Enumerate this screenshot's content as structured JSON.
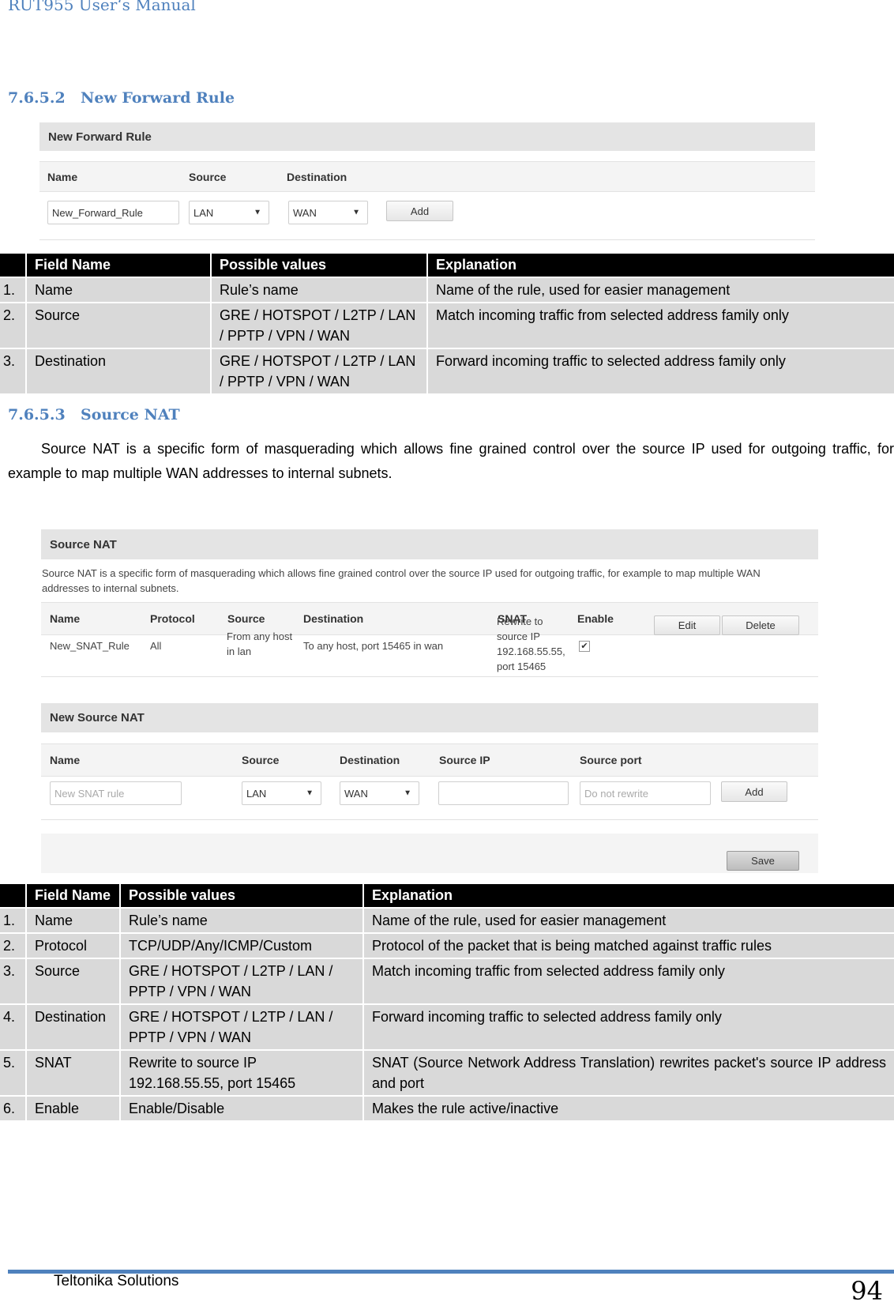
{
  "header": {
    "title": "RUT955 User‘s Manual"
  },
  "section1": {
    "number": "7.6.5.2",
    "title": "New Forward Rule",
    "screenshot": {
      "panel_title": "New Forward Rule",
      "columns": [
        "Name",
        "Source",
        "Destination"
      ],
      "name_value": "New_Forward_Rule",
      "source_value": "LAN",
      "destination_value": "WAN",
      "add_label": "Add",
      "arrow": "▼"
    },
    "table": {
      "headers": [
        "",
        "Field Name",
        "Possible values",
        "Explanation"
      ],
      "rows": [
        [
          "1.",
          "Name",
          "Rule’s name",
          "Name of the rule, used for easier management"
        ],
        [
          "2.",
          "Source",
          "GRE / HOTSPOT / L2TP / LAN / PPTP / VPN / WAN",
          "Match incoming traffic from selected address family only"
        ],
        [
          "3.",
          "Destination",
          "GRE / HOTSPOT / L2TP / LAN / PPTP / VPN / WAN",
          "Forward incoming traffic to selected address family only"
        ]
      ]
    }
  },
  "section2": {
    "number": "7.6.5.3",
    "title": "Source NAT",
    "paragraph": "Source NAT is a specific form of masquerading which allows fine grained control over the source IP used for outgoing traffic, for example to map multiple WAN addresses to internal subnets.",
    "screenshot": {
      "panel_title": "Source NAT",
      "description": "Source NAT is a specific form of masquerading which allows fine grained control over the source IP used for outgoing traffic, for example to map multiple WAN addresses to internal subnets.",
      "columns": [
        "Name",
        "Protocol",
        "Source",
        "Destination",
        "SNAT",
        "Enable"
      ],
      "rule": {
        "name": "New_SNAT_Rule",
        "protocol": "All",
        "source": "From any host in lan",
        "destination": "To any host, port 15465 in wan",
        "snat": "Rewrite to source IP 192.168.55.55, port 15465",
        "enabled_mark": "✔",
        "edit_label": "Edit",
        "delete_label": "Delete"
      },
      "new_panel_title": "New Source NAT",
      "new_columns": [
        "Name",
        "Source",
        "Destination",
        "Source IP",
        "Source port"
      ],
      "new_name_placeholder": "New SNAT rule",
      "new_source_value": "LAN",
      "new_destination_value": "WAN",
      "new_source_ip_value": "",
      "new_source_port_placeholder": "Do not rewrite",
      "add_label": "Add",
      "save_label": "Save",
      "arrow": "▼"
    },
    "table": {
      "headers": [
        "",
        "Field Name",
        "Possible values",
        "Explanation"
      ],
      "rows": [
        [
          "1.",
          "Name",
          "Rule’s name",
          "Name of the rule, used for easier management"
        ],
        [
          "2.",
          "Protocol",
          "TCP/UDP/Any/ICMP/Custom",
          "Protocol of the packet that is being matched against traffic rules"
        ],
        [
          "3.",
          "Source",
          "GRE / HOTSPOT / L2TP / LAN / PPTP / VPN / WAN",
          "Match incoming traffic from selected address family only"
        ],
        [
          "4.",
          "Destination",
          "GRE / HOTSPOT / L2TP / LAN / PPTP / VPN / WAN",
          "Forward incoming traffic to selected address family only"
        ],
        [
          "5.",
          "SNAT",
          "Rewrite to source IP 192.168.55.55, port 15465",
          "SNAT (Source Network Address Translation) rewrites packet's source IP address and port"
        ],
        [
          "6.",
          "Enable",
          "Enable/Disable",
          "Makes the rule active/inactive"
        ]
      ]
    }
  },
  "footer": {
    "company": "Teltonika Solutions",
    "page": "94"
  }
}
